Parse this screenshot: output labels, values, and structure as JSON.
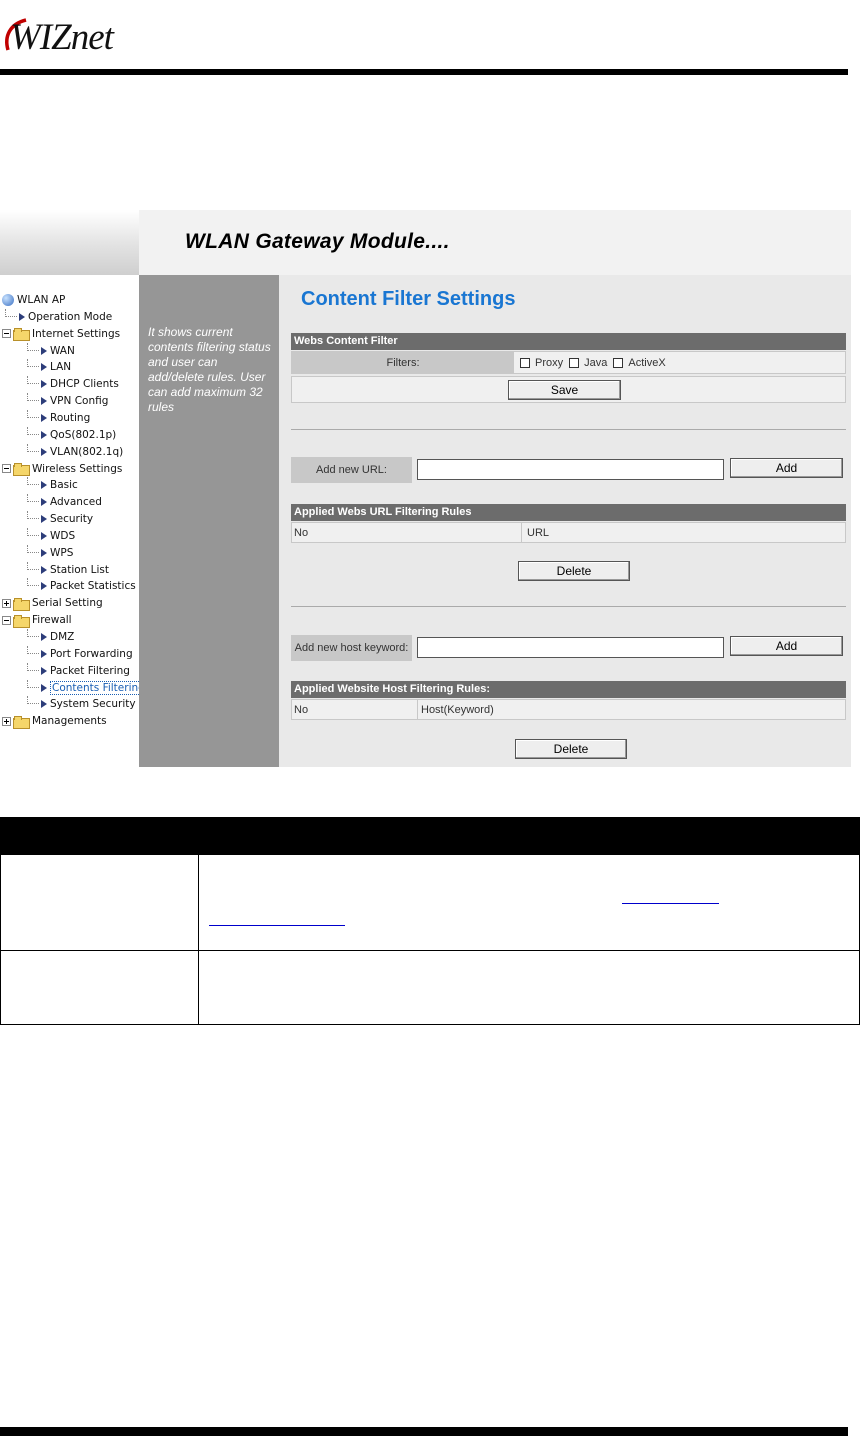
{
  "header": {
    "logo_text": "WIZnet"
  },
  "banner": {
    "title": "WLAN Gateway Module...."
  },
  "tree": {
    "root": "WLAN AP",
    "items": [
      {
        "label": "Operation Mode",
        "kind": "leaf",
        "level": 1
      },
      {
        "label": "Internet Settings",
        "kind": "folder-open",
        "level": 0
      },
      {
        "label": "WAN",
        "kind": "leaf",
        "level": 2
      },
      {
        "label": "LAN",
        "kind": "leaf",
        "level": 2
      },
      {
        "label": "DHCP Clients",
        "kind": "leaf",
        "level": 2
      },
      {
        "label": "VPN Config",
        "kind": "leaf",
        "level": 2
      },
      {
        "label": "Routing",
        "kind": "leaf",
        "level": 2
      },
      {
        "label": "QoS(802.1p)",
        "kind": "leaf",
        "level": 2
      },
      {
        "label": "VLAN(802.1q)",
        "kind": "leaf",
        "level": 2
      },
      {
        "label": "Wireless Settings",
        "kind": "folder-open",
        "level": 0
      },
      {
        "label": "Basic",
        "kind": "leaf",
        "level": 2
      },
      {
        "label": "Advanced",
        "kind": "leaf",
        "level": 2
      },
      {
        "label": "Security",
        "kind": "leaf",
        "level": 2
      },
      {
        "label": "WDS",
        "kind": "leaf",
        "level": 2
      },
      {
        "label": "WPS",
        "kind": "leaf",
        "level": 2
      },
      {
        "label": "Station List",
        "kind": "leaf",
        "level": 2
      },
      {
        "label": "Packet Statistics",
        "kind": "leaf",
        "level": 2
      },
      {
        "label": "Serial Setting",
        "kind": "folder-closed",
        "level": 0
      },
      {
        "label": "Firewall",
        "kind": "folder-open",
        "level": 0
      },
      {
        "label": "DMZ",
        "kind": "leaf",
        "level": 2
      },
      {
        "label": "Port Forwarding",
        "kind": "leaf",
        "level": 2
      },
      {
        "label": "Packet Filtering",
        "kind": "leaf",
        "level": 2
      },
      {
        "label": "Contents Filtering",
        "kind": "leaf",
        "level": 2,
        "selected": true
      },
      {
        "label": "System Security",
        "kind": "leaf",
        "level": 2
      },
      {
        "label": "Managements",
        "kind": "folder-closed",
        "level": 0
      }
    ]
  },
  "help": {
    "text": "It shows current contents filtering status and user can add/delete rules. User can add maximum 32 rules"
  },
  "content": {
    "title": "Content Filter Settings",
    "webs_filter": {
      "header": "Webs Content Filter",
      "filters_label": "Filters:",
      "options": [
        "Proxy",
        "Java",
        "ActiveX"
      ],
      "save_label": "Save"
    },
    "url_section": {
      "add_label": "Add new URL:",
      "add_value": "",
      "add_button": "Add",
      "rules_header": "Applied Webs URL Filtering Rules",
      "col_no": "No",
      "col_url": "URL",
      "delete_button": "Delete"
    },
    "host_section": {
      "add_label": "Add new host keyword:",
      "add_value": "",
      "add_button": "Add",
      "rules_header": "Applied Website Host Filtering Rules:",
      "col_no": "No",
      "col_host": "Host(Keyword)",
      "delete_button": "Delete"
    }
  }
}
